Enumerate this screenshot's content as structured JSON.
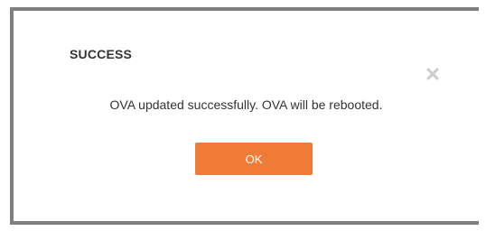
{
  "dialog": {
    "title": "SUCCESS",
    "close_icon": "close-icon",
    "message": "OVA updated successfully. OVA will be rebooted.",
    "ok_label": "OK"
  },
  "colors": {
    "accent": "#f07b36",
    "border": "#7f7f7f",
    "close_icon": "#cccccc",
    "text": "#333333"
  }
}
